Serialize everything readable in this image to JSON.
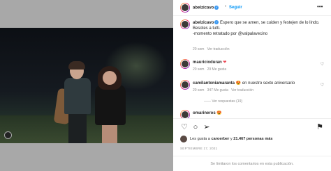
{
  "header": {
    "username": "abelzicavo",
    "separator": "•",
    "follow_label": "Seguir",
    "more_label": "•••"
  },
  "caption": {
    "username": "abelzicavo",
    "lines": [
      "Espero que se amen, se cuiden y festejen de lo lindo.",
      "Besotes a tutti.",
      "-momento retratado por @valpalavecino"
    ],
    "time": "20 sem",
    "translate": "Ver traducción"
  },
  "comments": [
    {
      "username": "mauricioduran",
      "text": "❤",
      "time": "20 sem",
      "likes": "29 Me gusta"
    },
    {
      "username": "camilantoniamaranta",
      "text": "😍 en nuestro sexto aniversario",
      "time": "20 sem",
      "likes": "347 Me gusta",
      "translate": "Ver traducción",
      "replies": "Ver respuestas (19)"
    },
    {
      "username": "omarineros",
      "text": "😍",
      "time": "",
      "likes": ""
    }
  ],
  "actions": {
    "likes_prefix": "Les gusta a",
    "liker": "caroerber",
    "likes_connector": "y",
    "likes_count": "21.467 personas más",
    "date": "SEPTIEMBRE 17, 2021"
  },
  "footer": {
    "text": "Se limitaron los comentarios en esta publicación."
  },
  "colors": {
    "accent": "#0095f6",
    "verified": "#3897f0",
    "backdrop": "#a8a8a8"
  }
}
